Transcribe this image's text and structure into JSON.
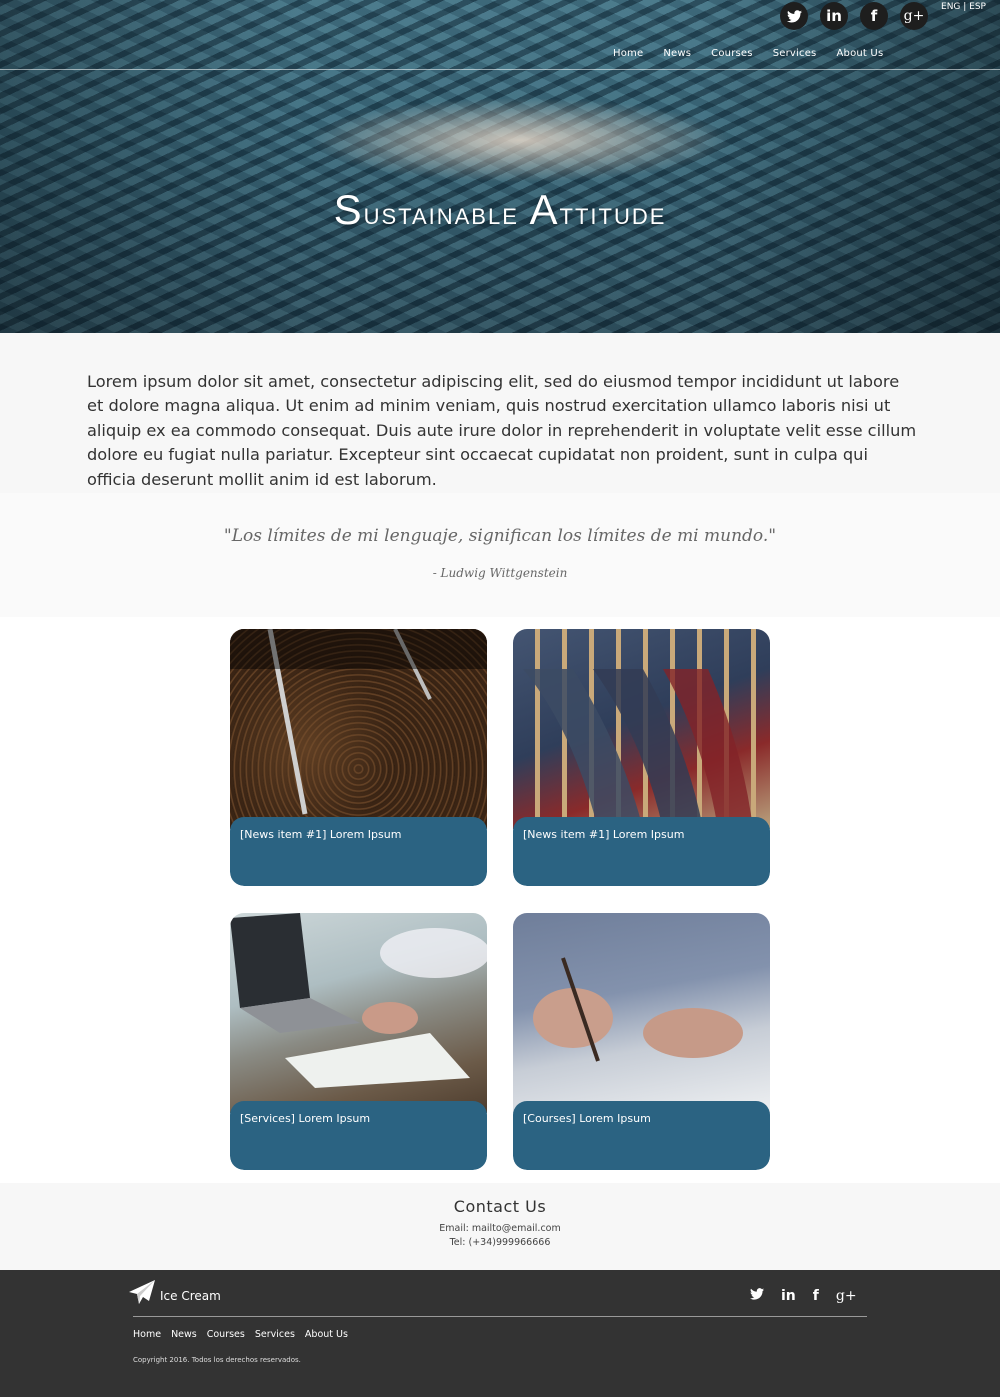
{
  "header": {
    "lang_label": "ENG | ESP",
    "social_icons": [
      "twitter-icon",
      "linkedin-icon",
      "facebook-icon",
      "google-plus-icon"
    ],
    "nav": [
      "Home",
      "News",
      "Courses",
      "Services",
      "About Us"
    ]
  },
  "hero": {
    "title_cap1": "S",
    "title_rest1": "ustainable ",
    "title_cap2": "A",
    "title_rest2": "ttitude"
  },
  "intro": {
    "text": "Lorem ipsum dolor sit amet, consectetur adipiscing elit, sed do eiusmod tempor incididunt ut labore et dolore magna aliqua. Ut enim ad minim veniam, quis nostrud exercitation ullamco laboris nisi ut aliquip ex ea commodo consequat. Duis aute irure dolor in reprehenderit in voluptate velit esse cillum dolore eu fugiat nulla pariatur. Excepteur sint occaecat cupidatat non proident, sunt in culpa qui officia deserunt mollit anim id est laborum."
  },
  "quote": {
    "text": "\"Los límites de mi lenguaje, significan los límites de mi mundo.\"",
    "author": "- Ludwig Wittgenstein"
  },
  "cards": [
    {
      "caption": "[News item #1] Lorem Ipsum"
    },
    {
      "caption": "[News item #1] Lorem Ipsum"
    },
    {
      "caption": "[Services] Lorem Ipsum"
    },
    {
      "caption": "[Courses] Lorem Ipsum"
    }
  ],
  "contact": {
    "title": "Contact Us",
    "email": "Email: mailto@email.com",
    "tel": "Tel: (+34)999966666"
  },
  "footer": {
    "brand": "Ice Cream",
    "nav": [
      "Home",
      "News",
      "Courses",
      "Services",
      "About Us"
    ],
    "copyright": "Copyright 2016. Todos los derechos reservados.",
    "social_icons": [
      "twitter-icon",
      "linkedin-icon",
      "facebook-icon",
      "google-plus-icon"
    ]
  },
  "colors": {
    "card_caption_bg": "#2b6382",
    "footer_bg": "#333333"
  }
}
